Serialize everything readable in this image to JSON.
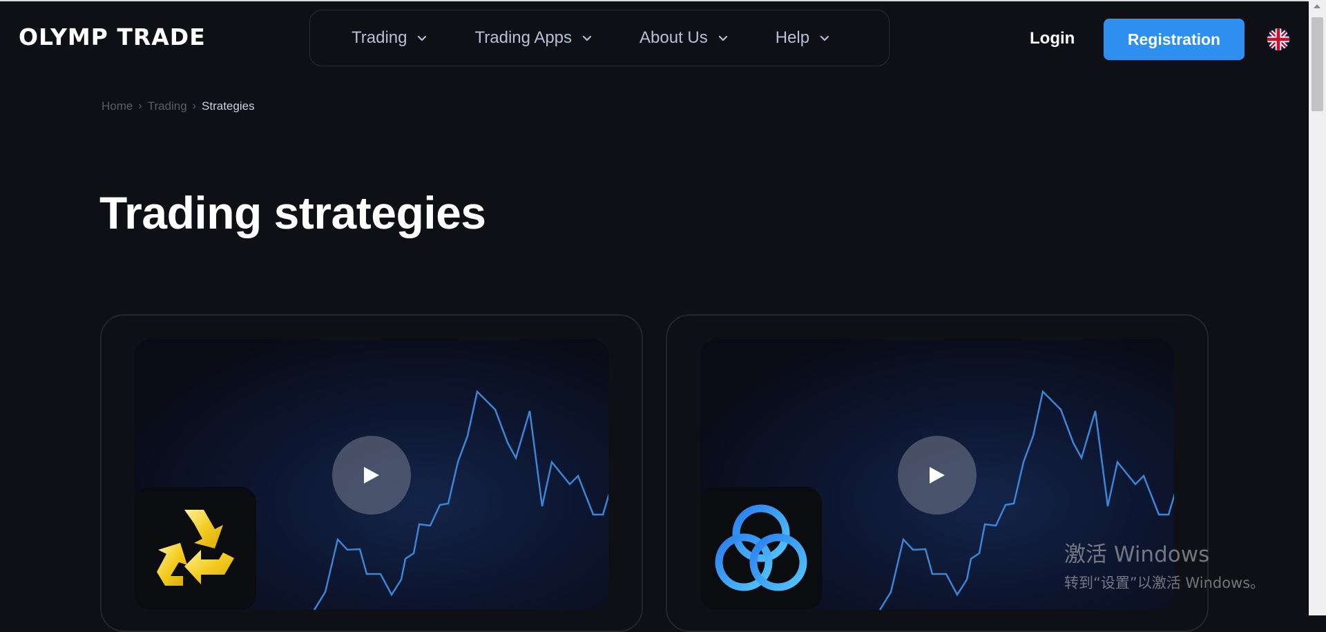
{
  "header": {
    "logo_text": "OLYMP TRADE",
    "nav": [
      {
        "label": "Trading"
      },
      {
        "label": "Trading Apps"
      },
      {
        "label": "About Us"
      },
      {
        "label": "Help"
      }
    ],
    "login_label": "Login",
    "register_label": "Registration",
    "language_flag": "uk-flag-icon",
    "accent_color": "#2e8ff0"
  },
  "breadcrumb": [
    {
      "label": "Home"
    },
    {
      "label": "Trading"
    },
    {
      "label": "Strategies"
    }
  ],
  "page_title": "Trading strategies",
  "cards": [
    {
      "icon": "recycle-arrows-icon",
      "icon_color": "#f2c41c"
    },
    {
      "icon": "interlocking-rings-icon",
      "icon_color": "#3aa0f5"
    }
  ],
  "watermark": {
    "title": "激活 Windows",
    "subtitle": "转到“设置”以激活 Windows。"
  }
}
